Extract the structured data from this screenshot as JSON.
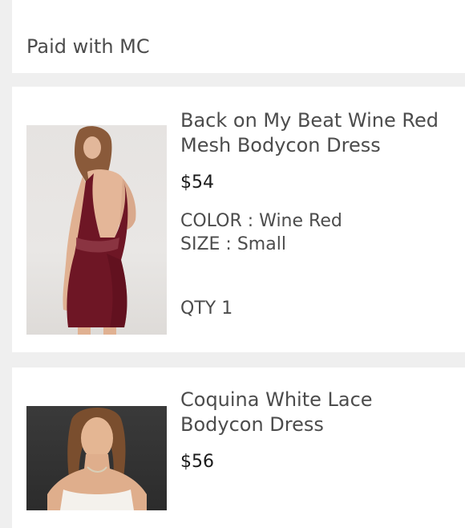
{
  "payment": {
    "label": "Paid with MC"
  },
  "items": [
    {
      "title_line1": "Back on My Beat Wine Red",
      "title_line2": "Mesh Bodycon Dress",
      "price": "$54",
      "color_label": "COLOR",
      "color_value": "Wine Red",
      "size_label": "SIZE",
      "size_value": "Small",
      "qty_label": "QTY",
      "qty_value": "1",
      "image_icon": "wine-red-dress-photo",
      "accent": "#6e1625"
    },
    {
      "title_line1": "Coquina White Lace",
      "title_line2": "Bodycon Dress",
      "price": "$56",
      "image_icon": "white-lace-dress-photo",
      "accent": "#f4f1ec"
    }
  ]
}
